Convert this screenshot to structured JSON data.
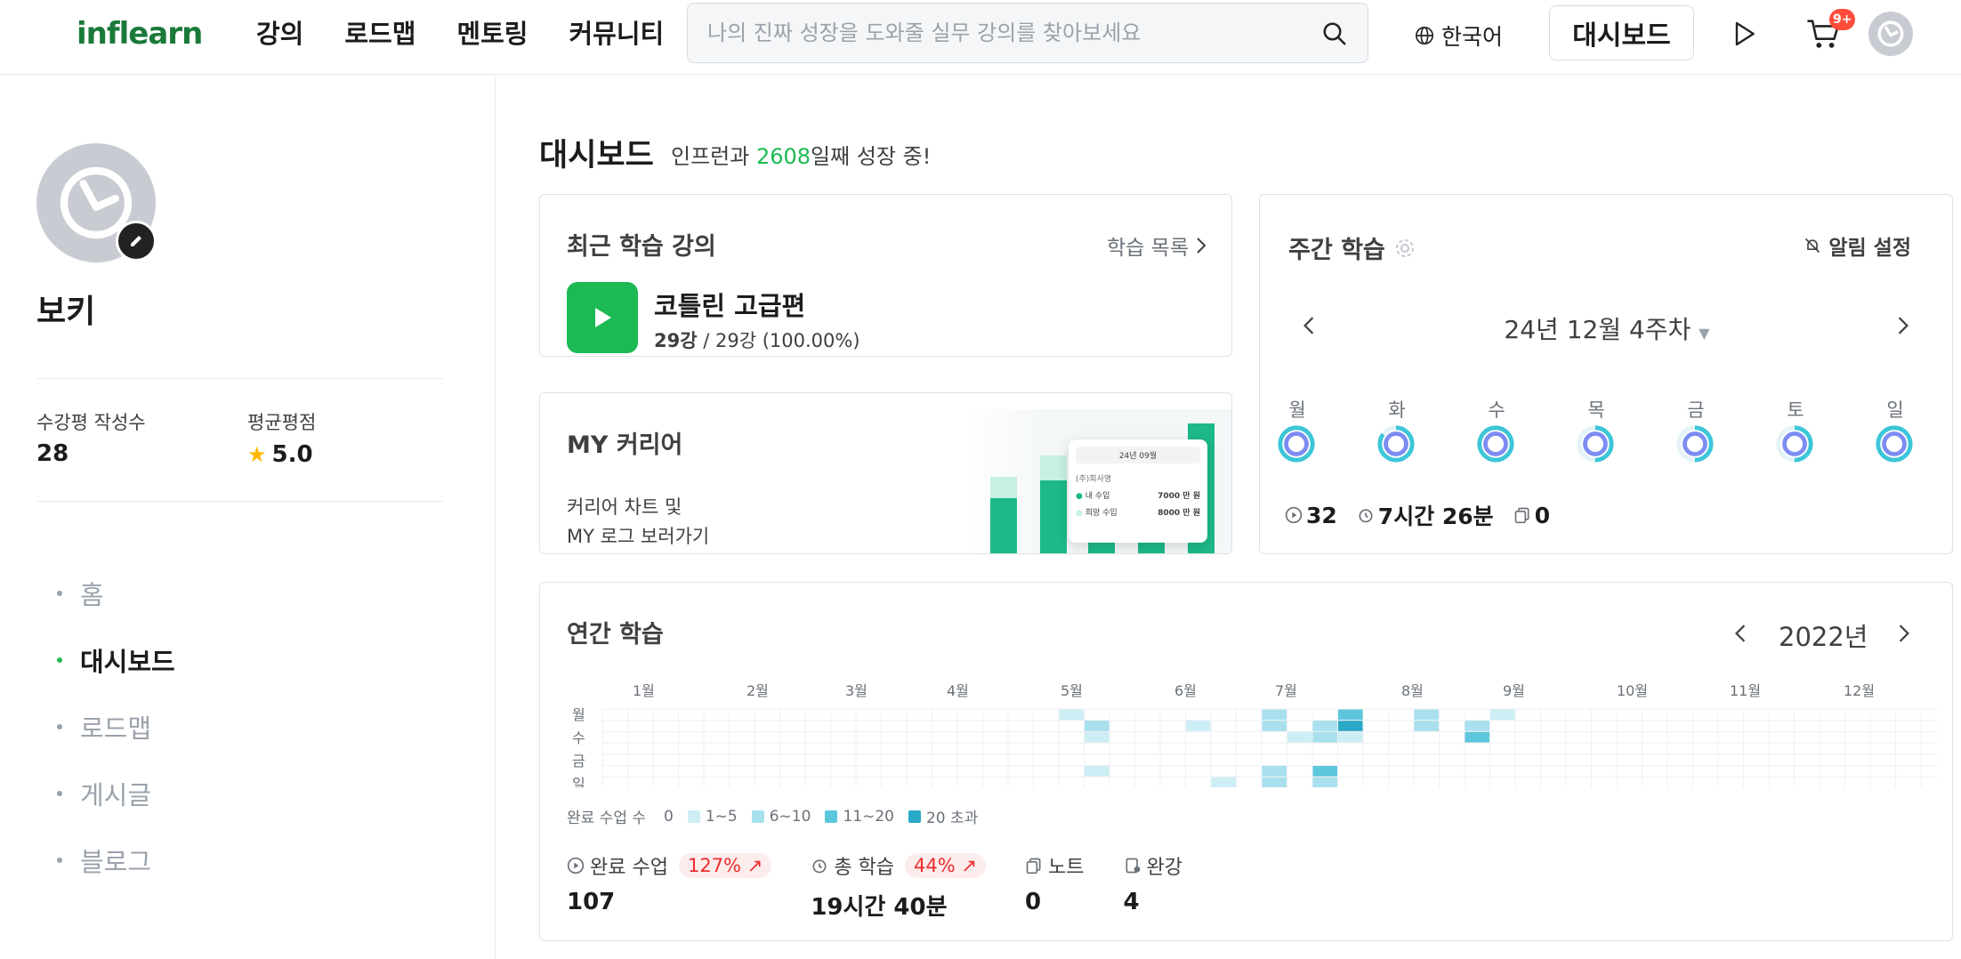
{
  "header": {
    "logo_text": "inflearn",
    "nav": [
      "강의",
      "로드맵",
      "멘토링",
      "커뮤니티"
    ],
    "search_placeholder": "나의 진짜 성장을 도와줄 실무 강의를 찾아보세요",
    "language": "한국어",
    "dashboard_button": "대시보드",
    "cart_badge": "9+"
  },
  "profile": {
    "name": "보키",
    "review_count_label": "수강평 작성수",
    "review_count": "28",
    "rating_label": "평균평점",
    "rating": "5.0"
  },
  "sidebar_menu": [
    "홈",
    "대시보드",
    "로드맵",
    "게시글",
    "블로그"
  ],
  "sidebar_active_index": 1,
  "dashboard": {
    "title": "대시보드",
    "subtitle_prefix": "인프런과 ",
    "days": "2608",
    "subtitle_suffix": "일째 성장 중!"
  },
  "recent": {
    "title": "최근 학습 강의",
    "list_link": "학습 목록",
    "course_title": "코틀린 고급편",
    "progress_done": "29강",
    "progress_rest": " / 29강 (100.00%)"
  },
  "career": {
    "title": "MY 커리어",
    "desc_line1": "커리어 차트 및",
    "desc_line2": "MY 로그 보러가기",
    "mock_month": "24년 09월",
    "mock_company": "(주)회사명",
    "mock_row1_label": "내 수입",
    "mock_row1_value": "7000 만 원",
    "mock_row2_label": "희망 수입",
    "mock_row2_value": "8000 만 원"
  },
  "weekly": {
    "title": "주간 학습",
    "alarm": "알림 설정",
    "week_label": "24년 12월 4주차",
    "days": [
      "월",
      "화",
      "수",
      "목",
      "금",
      "토",
      "일"
    ],
    "ring_fill": [
      1.0,
      0.85,
      1.0,
      0.5,
      0.5,
      0.5,
      1.0
    ],
    "stat_lectures": "32",
    "stat_time": "7시간 26분",
    "stat_notes": "0"
  },
  "yearly": {
    "title": "연간 학습",
    "year": "2022년",
    "months": [
      "1월",
      "2월",
      "3월",
      "4월",
      "5월",
      "6월",
      "7월",
      "8월",
      "9월",
      "10월",
      "11월",
      "12월"
    ],
    "weekdays": [
      "월",
      "수",
      "금",
      "일"
    ],
    "legend_title": "완료 수업 수",
    "legend": [
      "0",
      "1~5",
      "6~10",
      "11~20",
      "20 초과"
    ],
    "legend_colors": [
      "#ffffff",
      "#cdeef5",
      "#a8e0ee",
      "#5cc6dd",
      "#2aa9c8"
    ],
    "completed_label": "완료 수업",
    "completed_trend": "127%",
    "completed_value": "107",
    "total_label": "총 학습",
    "total_trend": "44%",
    "total_value": "19시간 40분",
    "notes_label": "노트",
    "notes_value": "0",
    "finished_label": "완강",
    "finished_value": "4"
  }
}
